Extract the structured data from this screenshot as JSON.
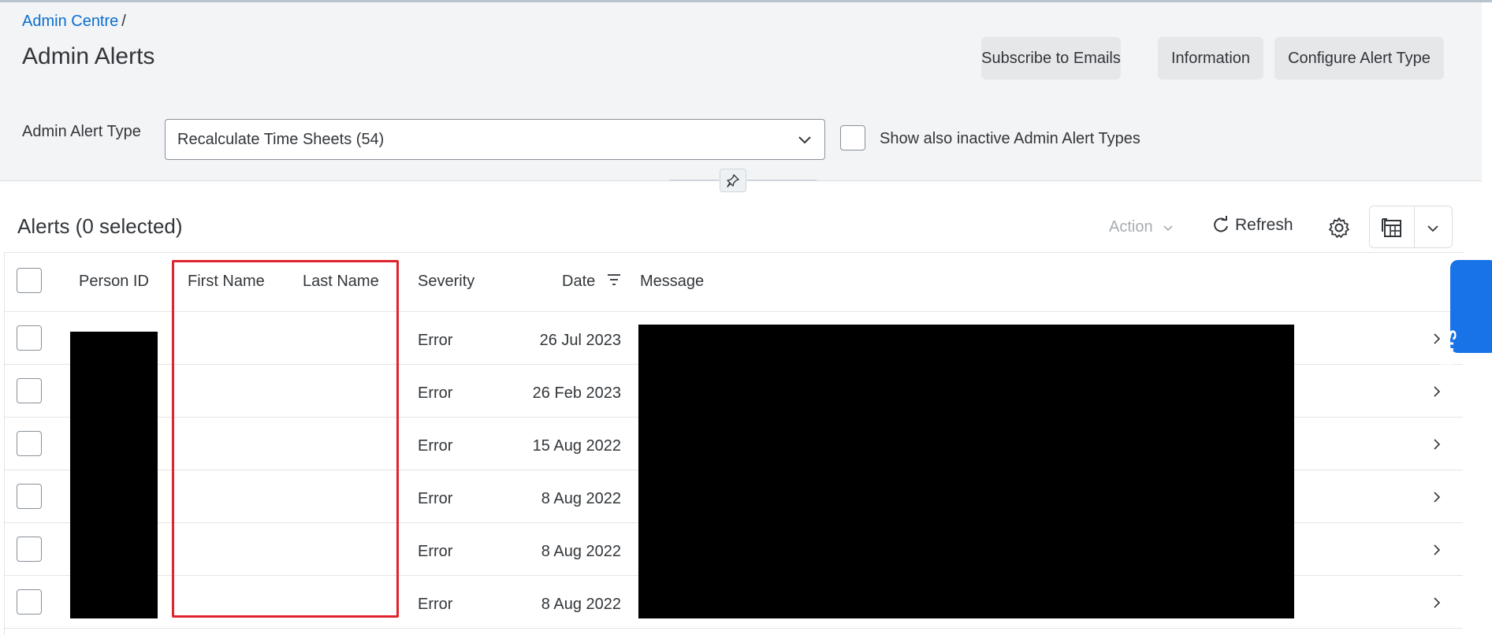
{
  "breadcrumb": {
    "link": "Admin Centre",
    "separator": "/"
  },
  "page_title": "Admin Alerts",
  "header_buttons": [
    "Subscribe to Emails",
    "Information",
    "Configure Alert Type"
  ],
  "filter": {
    "label": "Admin Alert Type",
    "selected": "Recalculate Time Sheets (54)",
    "inactive_label": "Show also inactive Admin Alert Types"
  },
  "toolbar": {
    "title": "Alerts (0 selected)",
    "action_label": "Action",
    "refresh_label": "Refresh"
  },
  "table": {
    "columns": [
      "Person ID",
      "First Name",
      "Last Name",
      "Severity",
      "Date",
      "Message"
    ],
    "rows": [
      {
        "severity": "Error",
        "date": "26 Jul 2023"
      },
      {
        "severity": "Error",
        "date": "26 Feb 2023"
      },
      {
        "severity": "Error",
        "date": "15 Aug 2022"
      },
      {
        "severity": "Error",
        "date": "8 Aug 2022"
      },
      {
        "severity": "Error",
        "date": "8 Aug 2022"
      },
      {
        "severity": "Error",
        "date": "8 Aug 2022"
      }
    ]
  },
  "support_label": "Support",
  "colors": {
    "link": "#0a6ed1",
    "highlight": "#e0242e",
    "support": "#1873e8"
  }
}
